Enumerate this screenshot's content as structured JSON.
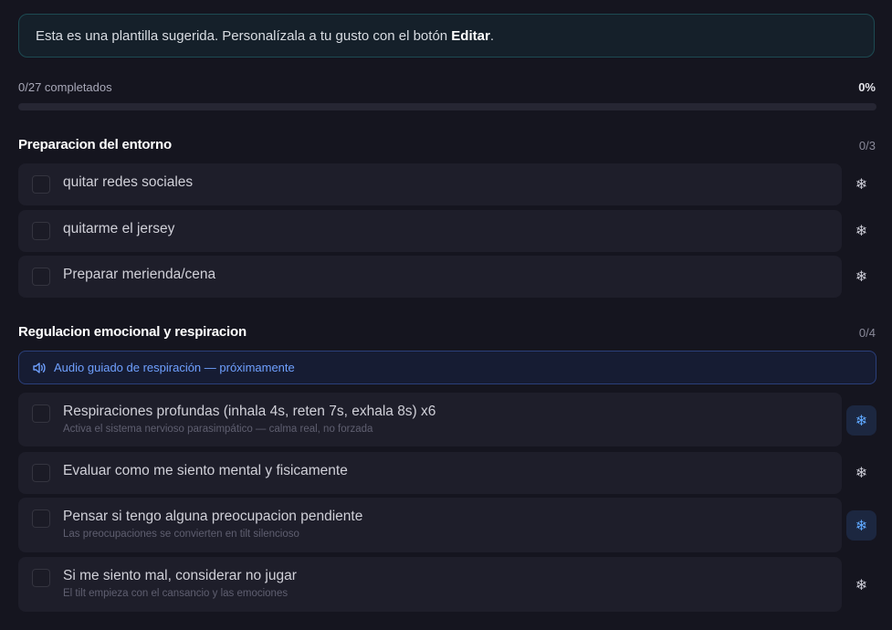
{
  "banner": {
    "text_before": "Esta es una plantilla sugerida. Personalízala a tu gusto con el botón ",
    "text_bold": "Editar",
    "text_after": "."
  },
  "progress": {
    "label": "0/27 completados",
    "percent_label": "0%",
    "fraction": 0
  },
  "sections": [
    {
      "title": "Preparacion del entorno",
      "count": "0/3",
      "tasks": [
        {
          "label": "quitar redes sociales",
          "sub": "",
          "starred": false
        },
        {
          "label": "quitarme el jersey",
          "sub": "",
          "starred": false
        },
        {
          "label": "Preparar merienda/cena",
          "sub": "",
          "starred": false
        }
      ]
    },
    {
      "title": "Regulacion emocional y respiracion",
      "count": "0/4",
      "audio_note": "Audio guiado de respiración — próximamente",
      "tasks": [
        {
          "label": "Respiraciones profundas (inhala 4s, reten 7s, exhala 8s) x6",
          "sub": "Activa el sistema nervioso parasimpático — calma real, no forzada",
          "starred": true
        },
        {
          "label": "Evaluar como me siento mental y fisicamente",
          "sub": "",
          "starred": false
        },
        {
          "label": "Pensar si tengo alguna preocupacion pendiente",
          "sub": "Las preocupaciones se convierten en tilt silencioso",
          "starred": true
        },
        {
          "label": "Si me siento mal, considerar no jugar",
          "sub": "El tilt empieza con el cansancio y las emociones",
          "starred": false
        }
      ]
    }
  ],
  "icons": {
    "snowflake": "snowflake-icon",
    "speaker": "speaker-icon"
  },
  "colors": {
    "accent": "#5fa8ff",
    "background": "#15151f",
    "card": "#1e1e2a"
  }
}
